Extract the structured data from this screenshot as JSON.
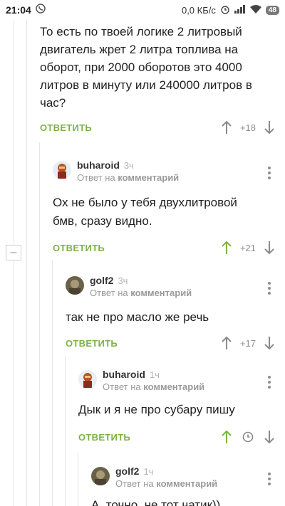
{
  "status_bar": {
    "time": "21:04",
    "speed": "0,0 КБ/с",
    "battery": "48"
  },
  "colors": {
    "accent_green": "#7bb343",
    "muted_gray": "#9a9a9a"
  },
  "comments": [
    {
      "body": "То есть по твоей логике 2 литровый двигатель жрет 2 литра топлива на оборот, при 2000 оборотов это 4000 литров в минуту или 240000 литров в час?",
      "reply_label": "ОТВЕТИТЬ",
      "rating": "+18"
    },
    {
      "author": "buharoid",
      "time": "3ч",
      "reply_prefix": "Ответ на",
      "reply_target": "комментарий",
      "body": "Ох не было у тебя двухлитровой бмв, сразу видно.",
      "reply_label": "ОТВЕТИТЬ",
      "rating": "+21",
      "voted": "up"
    },
    {
      "author": "golf2",
      "time": "3ч",
      "reply_prefix": "Ответ на",
      "reply_target": "комментарий",
      "body": "так не про масло же речь",
      "reply_label": "ОТВЕТИТЬ",
      "rating": "+17"
    },
    {
      "author": "buharoid",
      "time": "1ч",
      "reply_prefix": "Ответ на",
      "reply_target": "комментарий",
      "body": "Дык и я не про субару пишу",
      "reply_label": "ОТВЕТИТЬ",
      "voted": "up",
      "rating_icon": "clock-icon"
    },
    {
      "author": "golf2",
      "time": "1ч",
      "reply_prefix": "Ответ на",
      "reply_target": "комментарий",
      "body": "А, точно, не тот чатик))"
    }
  ]
}
